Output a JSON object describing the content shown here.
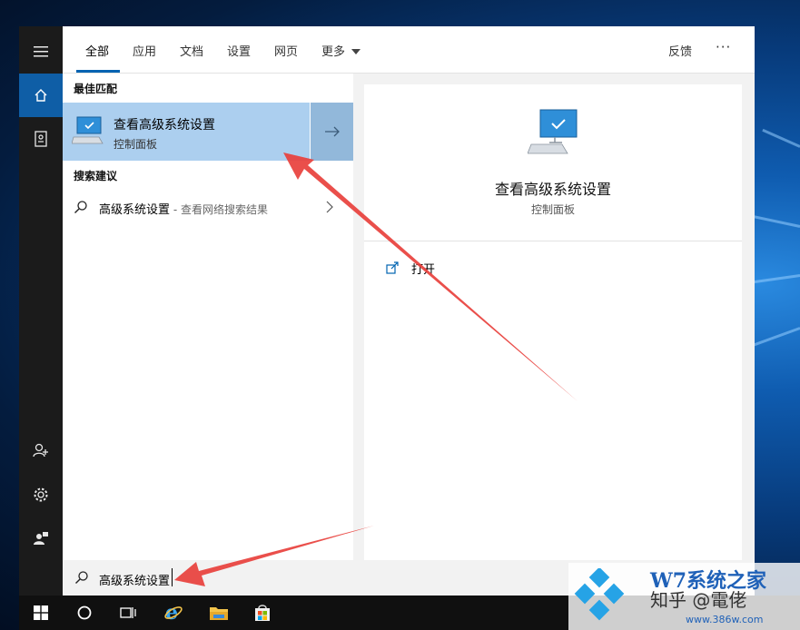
{
  "tabs": [
    {
      "label": "全部"
    },
    {
      "label": "应用"
    },
    {
      "label": "文档"
    },
    {
      "label": "设置"
    },
    {
      "label": "网页"
    },
    {
      "label": "更多"
    }
  ],
  "feedback_label": "反馈",
  "more_options_label": "···",
  "best_match": {
    "section_title": "最佳匹配",
    "title": "查看高级系统设置",
    "subtitle": "控制面板"
  },
  "suggestions": {
    "section_title": "搜索建议",
    "query": "高级系统设置",
    "hint": " - 查看网络搜索结果"
  },
  "preview": {
    "title": "查看高级系统设置",
    "subtitle": "控制面板",
    "open_label": "打开"
  },
  "search": {
    "value": "高级系统设置"
  },
  "watermark": {
    "brand": "W7系统之家",
    "mark": "知乎 @電佬",
    "url": "www.386w.com"
  },
  "colors": {
    "accent": "#0063b1",
    "highlight": "#accfef",
    "arrow": "#e8403c"
  }
}
